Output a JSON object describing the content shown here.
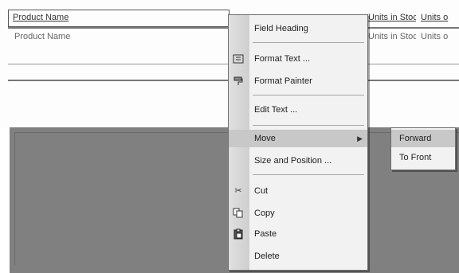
{
  "report": {
    "header_cells": [
      "Product Name",
      "Units in Stock",
      "Units o"
    ],
    "detail_cells": [
      "Product Name",
      "Units in Stock",
      "Units o"
    ]
  },
  "context_menu": {
    "items": {
      "field_heading": "Field Heading",
      "format_text": "Format Text ...",
      "format_painter": "Format Painter",
      "edit_text": "Edit Text ...",
      "move": "Move",
      "size_and_position": "Size and Position ...",
      "cut": "Cut",
      "copy": "Copy",
      "paste": "Paste",
      "delete": "Delete"
    }
  },
  "submenu": {
    "items": {
      "forward": "Forward",
      "to_front": "To Front"
    }
  },
  "colors": {
    "menu_bg": "#f2f2f2",
    "highlight": "#c8c8c8",
    "gray_area": "#808080"
  },
  "icons": [
    "format-text-icon",
    "format-painter-icon",
    "cut-icon",
    "copy-icon",
    "paste-icon",
    "submenu-arrow-icon"
  ]
}
